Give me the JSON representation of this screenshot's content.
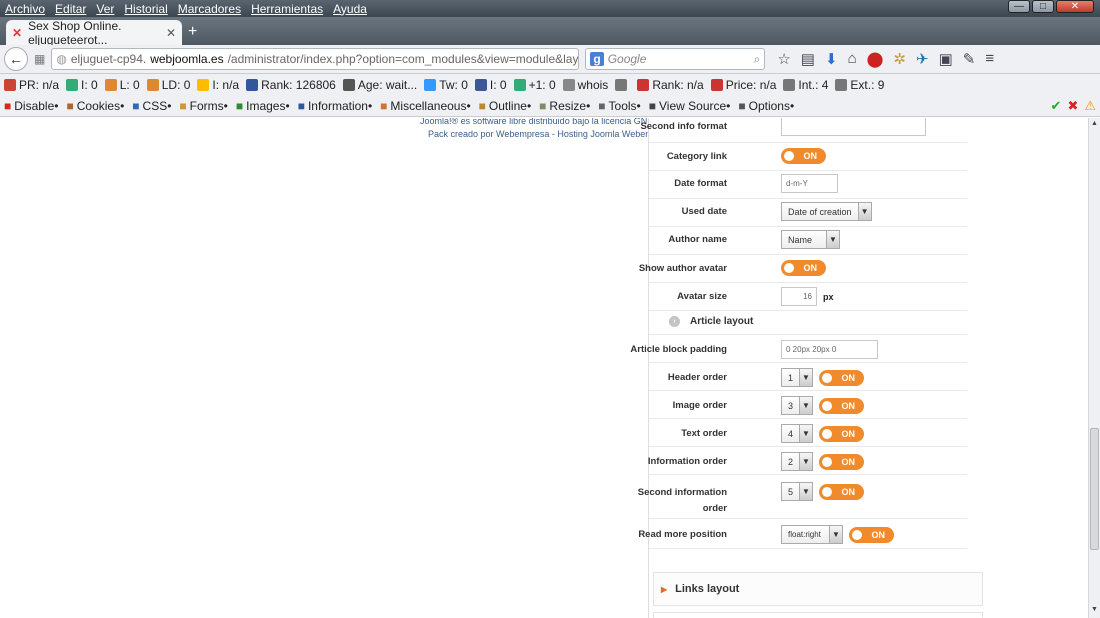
{
  "menu": [
    "Archivo",
    "Editar",
    "Ver",
    "Historial",
    "Marcadores",
    "Herramientas",
    "Ayuda"
  ],
  "window_buttons": {
    "min": "—",
    "max": "□",
    "close": "✕"
  },
  "tab": {
    "title": "Sex Shop Online. eljugueteerot..."
  },
  "url": {
    "pre": "eljuguet-cp94.",
    "host": "webjoomla.es",
    "path": "/administrator/index.php?option=com_modules&view=module&layout=edit&id=1"
  },
  "search": {
    "placeholder": "Google"
  },
  "seo_items": [
    {
      "text": "PR: n/a",
      "color": "#c43"
    },
    {
      "text": "I: 0",
      "color": "#3a7"
    },
    {
      "text": "L: 0",
      "color": "#d83"
    },
    {
      "text": "LD: 0",
      "color": "#d83"
    },
    {
      "text": "I: n/a",
      "color": "#fb0"
    },
    {
      "text": "Rank: 126806",
      "color": "#359"
    },
    {
      "text": "Age: wait...",
      "color": "#555"
    },
    {
      "text": "Tw: 0",
      "color": "#39f"
    },
    {
      "text": "I: 0",
      "color": "#3b5998"
    },
    {
      "text": "+1: 0",
      "color": "#3a7"
    },
    {
      "text": "whois",
      "color": "#888"
    },
    {
      "text": "",
      "color": "#777"
    },
    {
      "text": "Rank: n/a",
      "color": "#c33"
    },
    {
      "text": "Price: n/a",
      "color": "#c33"
    },
    {
      "text": "Int.: 4",
      "color": "#777"
    },
    {
      "text": "Ext.: 9",
      "color": "#777"
    }
  ],
  "dev_items": [
    "Disable•",
    "Cookies•",
    "CSS•",
    "Forms•",
    "Images•",
    "Information•",
    "Miscellaneous•",
    "Outline•",
    "Resize•",
    "Tools•",
    "View Source•",
    "Options•"
  ],
  "footer": {
    "line1": "Joomla!® es software libre distribuido bajo la licencia GNU",
    "line2": "Pack creado por Webempresa - Hosting Joomla Webempr"
  },
  "form": {
    "second_info_format": {
      "label": "Second info format",
      "value": ""
    },
    "category_link": {
      "label": "Category link",
      "toggle": "ON"
    },
    "date_format": {
      "label": "Date format",
      "value": "d-m-Y"
    },
    "used_date": {
      "label": "Used date",
      "value": "Date of creation"
    },
    "author_name": {
      "label": "Author name",
      "value": "Name"
    },
    "show_author_avatar": {
      "label": "Show author avatar",
      "toggle": "ON"
    },
    "avatar_size": {
      "label": "Avatar size",
      "value": "16",
      "unit": "px"
    },
    "article_layout": {
      "label": "Article layout"
    },
    "article_block_padding": {
      "label": "Article block padding",
      "value": "0 20px 20px 0"
    },
    "header_order": {
      "label": "Header order",
      "value": "1",
      "toggle": "ON"
    },
    "image_order": {
      "label": "Image order",
      "value": "3",
      "toggle": "ON"
    },
    "text_order": {
      "label": "Text order",
      "value": "4",
      "toggle": "ON"
    },
    "information_order": {
      "label": "Information order",
      "value": "2",
      "toggle": "ON"
    },
    "second_information_order": {
      "label1": "Second information",
      "label2": "order",
      "value": "5",
      "toggle": "ON"
    },
    "read_more_position": {
      "label": "Read more position",
      "value": "float:right",
      "toggle": "ON"
    }
  },
  "links_layout": {
    "label": "Links layout"
  }
}
